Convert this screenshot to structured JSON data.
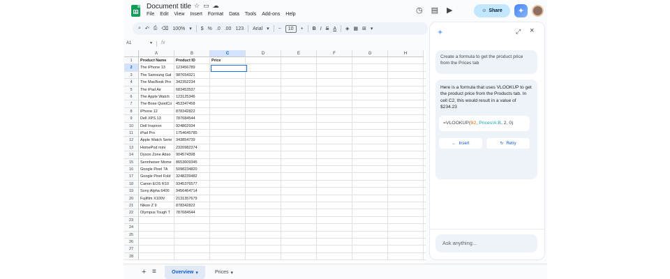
{
  "header": {
    "title": "Document title",
    "menu": [
      "File",
      "Edit",
      "View",
      "Insert",
      "Format",
      "Data",
      "Tools",
      "Add-ons",
      "Help"
    ],
    "share_label": "Share"
  },
  "toolbar": {
    "zoom": "100%",
    "currency": "$",
    "percent": "%",
    "dec_dec": ".0",
    "dec_inc": ".00",
    "number_format": "123",
    "font": "Arial",
    "font_size": "10",
    "bold": "B",
    "italic": "I",
    "strike": "S",
    "text_color": "A"
  },
  "formula_bar": {
    "cell_ref": "A1",
    "fx": "fx"
  },
  "grid": {
    "columns": [
      "A",
      "B",
      "C",
      "D",
      "E",
      "F",
      "G",
      "H"
    ],
    "selected_column": "C",
    "selected_row": 2,
    "rows": [
      [
        "Product Name",
        "Product ID",
        "Price"
      ],
      [
        "The iPhone 13",
        "123456789",
        ""
      ],
      [
        "The Samsung Gal",
        "987654321",
        ""
      ],
      [
        "The MacBook Pro",
        "342352234",
        ""
      ],
      [
        "The iPad Air",
        "683453537",
        ""
      ],
      [
        "The Apple Watch",
        "123125346",
        ""
      ],
      [
        "The Bose QuietCo",
        "453347458",
        ""
      ],
      [
        "iPhone 12",
        "878342822",
        ""
      ],
      [
        "Dell XPS 13",
        "787684544",
        ""
      ],
      [
        "Dell Inspiron",
        "924802934",
        ""
      ],
      [
        "iPad Pro",
        "1754645785",
        ""
      ],
      [
        "Apple Watch Serie",
        "343854739",
        ""
      ],
      [
        "HomePod mini",
        "2320982374",
        ""
      ],
      [
        "Dyson Zone Abso",
        "904574398",
        ""
      ],
      [
        "Sennheiser Mome",
        "8653609345",
        ""
      ],
      [
        "Google Pixel 7A",
        "5098234820",
        ""
      ],
      [
        "Google Pixel Fold",
        "3248239482",
        ""
      ],
      [
        "Canon EOS R10",
        "9345376577",
        ""
      ],
      [
        "Sony Alpha 6400",
        "9456464714",
        ""
      ],
      [
        "Fujifilm X100V",
        "2131357679",
        ""
      ],
      [
        "Nikon Z 9",
        "878342822",
        ""
      ],
      [
        "Olympus Tough T",
        "787684544",
        ""
      ],
      [
        "",
        "",
        ""
      ],
      [
        "",
        "",
        ""
      ],
      [
        "",
        "",
        ""
      ],
      [
        "",
        "",
        ""
      ],
      [
        "",
        "",
        ""
      ],
      [
        "",
        "",
        ""
      ]
    ]
  },
  "sheets": {
    "tabs": [
      {
        "label": "Overview",
        "active": true
      },
      {
        "label": "Prices",
        "active": false
      }
    ]
  },
  "panel": {
    "user_prompt": "Create a formula to get the product price from the Prices tab",
    "reply_text": "Here is a formula that uses VLOOKUP to get the product price from the Products tab. In cell C2, this would result in a value of $234.23",
    "formula": {
      "prefix": "=VLOOKUP(",
      "arg1": "B2",
      "sep1": ", ",
      "arg2": "Prices!A:B",
      "rest": ", 2, 0)"
    },
    "insert_label": "Insert",
    "retry_label": "Retry",
    "ask_placeholder": "Ask anything..."
  },
  "colors": {
    "accent": "#0b57d0",
    "share_bg": "#c2e7ff",
    "sheets_green": "#0f9d58",
    "formula_ref": "#e37400",
    "formula_range": "#12a4af"
  }
}
